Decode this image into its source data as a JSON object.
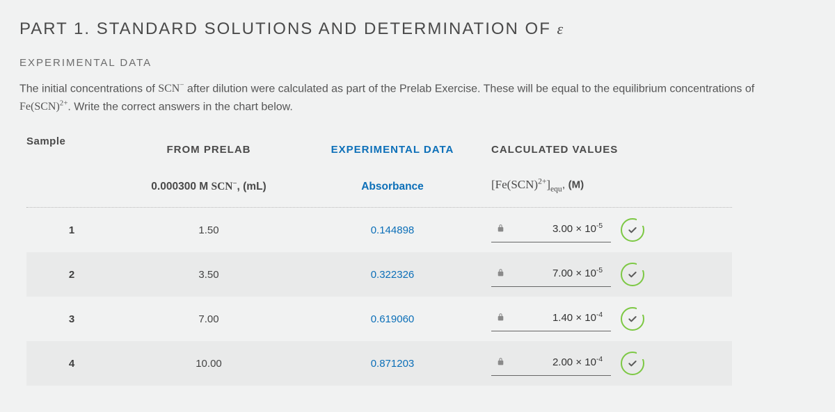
{
  "title_main": "PART 1. STANDARD SOLUTIONS AND DETERMINATION OF ",
  "title_eps": "ε",
  "subheading": "EXPERIMENTAL DATA",
  "intro_a": "The initial concentrations of ",
  "intro_b": " after dilution were calculated as part of the Prelab Exercise. These will be equal to the equilibrium concentrations of ",
  "intro_c": ". Write the correct answers in the chart below.",
  "group_labels": {
    "sample": "Sample",
    "prelab": "FROM PRELAB",
    "exp": "EXPERIMENTAL DATA",
    "calc": "CALCULATED VALUES"
  },
  "col_headers": {
    "prelab_prefix": "0.000300 M ",
    "prelab_species": "SCN",
    "prelab_suffix": ", (mL)",
    "exp": "Absorbance",
    "calc_prefix": "[Fe(SCN)",
    "calc_sup": "2+",
    "calc_sub": "equ",
    "calc_suffix": ", ",
    "calc_unit": "(M)"
  },
  "rows": [
    {
      "n": "1",
      "prelab": "1.50",
      "abs": "0.144898",
      "val_base": "3.00 × 10",
      "val_exp": "-5"
    },
    {
      "n": "2",
      "prelab": "3.50",
      "abs": "0.322326",
      "val_base": "7.00 × 10",
      "val_exp": "-5"
    },
    {
      "n": "3",
      "prelab": "7.00",
      "abs": "0.619060",
      "val_base": "1.40 × 10",
      "val_exp": "-4"
    },
    {
      "n": "4",
      "prelab": "10.00",
      "abs": "0.871203",
      "val_base": "2.00 × 10",
      "val_exp": "-4"
    }
  ]
}
